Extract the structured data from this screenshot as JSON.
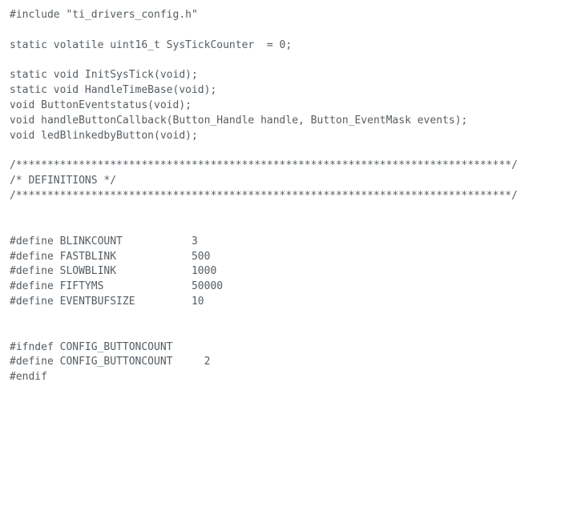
{
  "code": {
    "lines": [
      "#include \"ti_drivers_config.h\"",
      "",
      "static volatile uint16_t SysTickCounter  = 0;",
      "",
      "static void InitSysTick(void);",
      "static void HandleTimeBase(void);",
      "void ButtonEventstatus(void);",
      "void handleButtonCallback(Button_Handle handle, Button_EventMask events);",
      "void ledBlinkedbyButton(void);",
      "",
      "/*******************************************************************************/",
      "/* DEFINITIONS */",
      "/*******************************************************************************/",
      "",
      "",
      "#define BLINKCOUNT           3",
      "#define FASTBLINK            500",
      "#define SLOWBLINK            1000",
      "#define FIFTYMS              50000",
      "#define EVENTBUFSIZE         10",
      "",
      "",
      "#ifndef CONFIG_BUTTONCOUNT",
      "#define CONFIG_BUTTONCOUNT     2",
      "#endif"
    ]
  }
}
